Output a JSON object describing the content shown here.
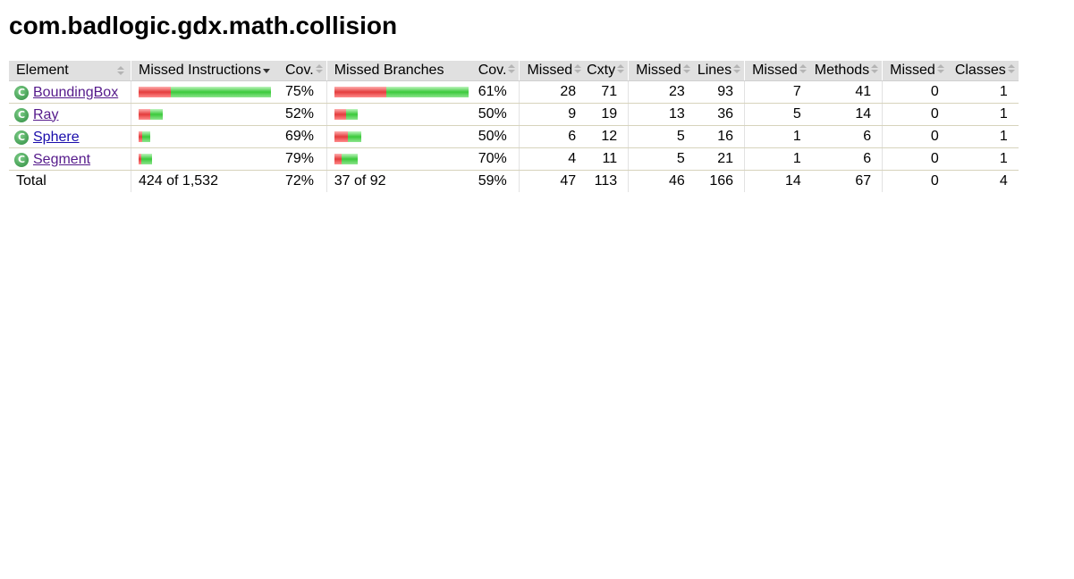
{
  "page": {
    "title": "com.badlogic.gdx.math.collision"
  },
  "columns": {
    "element": "Element",
    "missed_instructions": "Missed Instructions",
    "cov1": "Cov.",
    "missed_branches": "Missed Branches",
    "cov2": "Cov.",
    "missed_cxty": "Missed",
    "cxty": "Cxty",
    "missed_lines": "Missed",
    "lines": "Lines",
    "missed_methods": "Missed",
    "methods": "Methods",
    "missed_classes": "Missed",
    "classes": "Classes"
  },
  "rows": [
    {
      "name": "BoundingBox",
      "instr_missed_frac": 0.245,
      "instr_cov_frac": 0.755,
      "instr_scale": 1.0,
      "instr_cov": "75%",
      "branch_missed_frac": 0.385,
      "branch_scale": 1.0,
      "branch_cov": "61%",
      "missed_cxty": "28",
      "cxty": "71",
      "missed_lines": "23",
      "lines": "93",
      "missed_methods": "7",
      "methods": "41",
      "missed_classes": "0",
      "classes": "1"
    },
    {
      "name": "Ray",
      "instr_missed_frac": 0.48,
      "instr_scale": 0.185,
      "instr_cov": "52%",
      "branch_missed_frac": 0.5,
      "branch_scale": 0.17,
      "branch_cov": "50%",
      "missed_cxty": "9",
      "cxty": "19",
      "missed_lines": "13",
      "lines": "36",
      "missed_methods": "5",
      "methods": "14",
      "missed_classes": "0",
      "classes": "1"
    },
    {
      "name": "Sphere",
      "instr_missed_frac": 0.31,
      "instr_scale": 0.09,
      "instr_cov": "69%",
      "branch_missed_frac": 0.5,
      "branch_scale": 0.2,
      "branch_cov": "50%",
      "missed_cxty": "6",
      "cxty": "12",
      "missed_lines": "5",
      "lines": "16",
      "missed_methods": "1",
      "methods": "6",
      "missed_classes": "0",
      "classes": "1"
    },
    {
      "name": "Segment",
      "instr_missed_frac": 0.21,
      "instr_scale": 0.1,
      "instr_cov": "79%",
      "branch_missed_frac": 0.3,
      "branch_scale": 0.17,
      "branch_cov": "70%",
      "missed_cxty": "4",
      "cxty": "11",
      "missed_lines": "5",
      "lines": "21",
      "missed_methods": "1",
      "methods": "6",
      "missed_classes": "0",
      "classes": "1"
    }
  ],
  "total": {
    "label": "Total",
    "instr": "424 of 1,532",
    "instr_cov": "72%",
    "branch": "37 of 92",
    "branch_cov": "59%",
    "missed_cxty": "47",
    "cxty": "113",
    "missed_lines": "46",
    "lines": "166",
    "missed_methods": "14",
    "methods": "67",
    "missed_classes": "0",
    "classes": "4"
  },
  "colors": {
    "missed": "#e43c3c",
    "covered": "#3bc93b",
    "header_bg": "#e0e0e0"
  },
  "icons": {
    "class": "class-c-icon",
    "sort": "sort-arrows-icon",
    "sort_active": "sort-desc-icon"
  }
}
